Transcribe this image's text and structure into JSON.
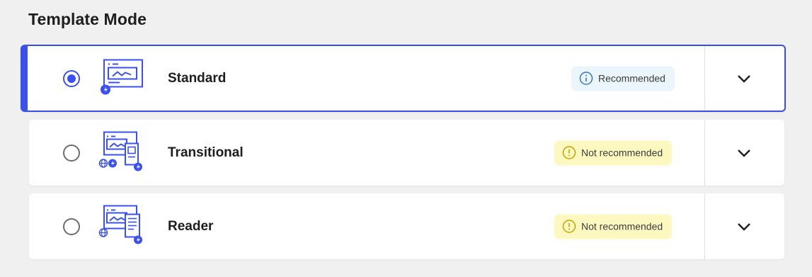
{
  "section": {
    "title": "Template Mode"
  },
  "modes": [
    {
      "title": "Standard",
      "selected": true,
      "badge": {
        "label": "Recommended",
        "type": "info",
        "icon": "info-icon"
      },
      "icon": "standard-mode-icon"
    },
    {
      "title": "Transitional",
      "selected": false,
      "badge": {
        "label": "Not recommended",
        "type": "warning",
        "icon": "warning-icon"
      },
      "icon": "transitional-mode-icon"
    },
    {
      "title": "Reader",
      "selected": false,
      "badge": {
        "label": "Not recommended",
        "type": "warning",
        "icon": "warning-icon"
      },
      "icon": "reader-mode-icon"
    }
  ],
  "colors": {
    "accent": "#3b50f2",
    "info_bg": "#eaf6fc",
    "warning_bg": "#fdf8c0",
    "info_icon": "#3a74c4",
    "warning_icon": "#c9a100"
  }
}
